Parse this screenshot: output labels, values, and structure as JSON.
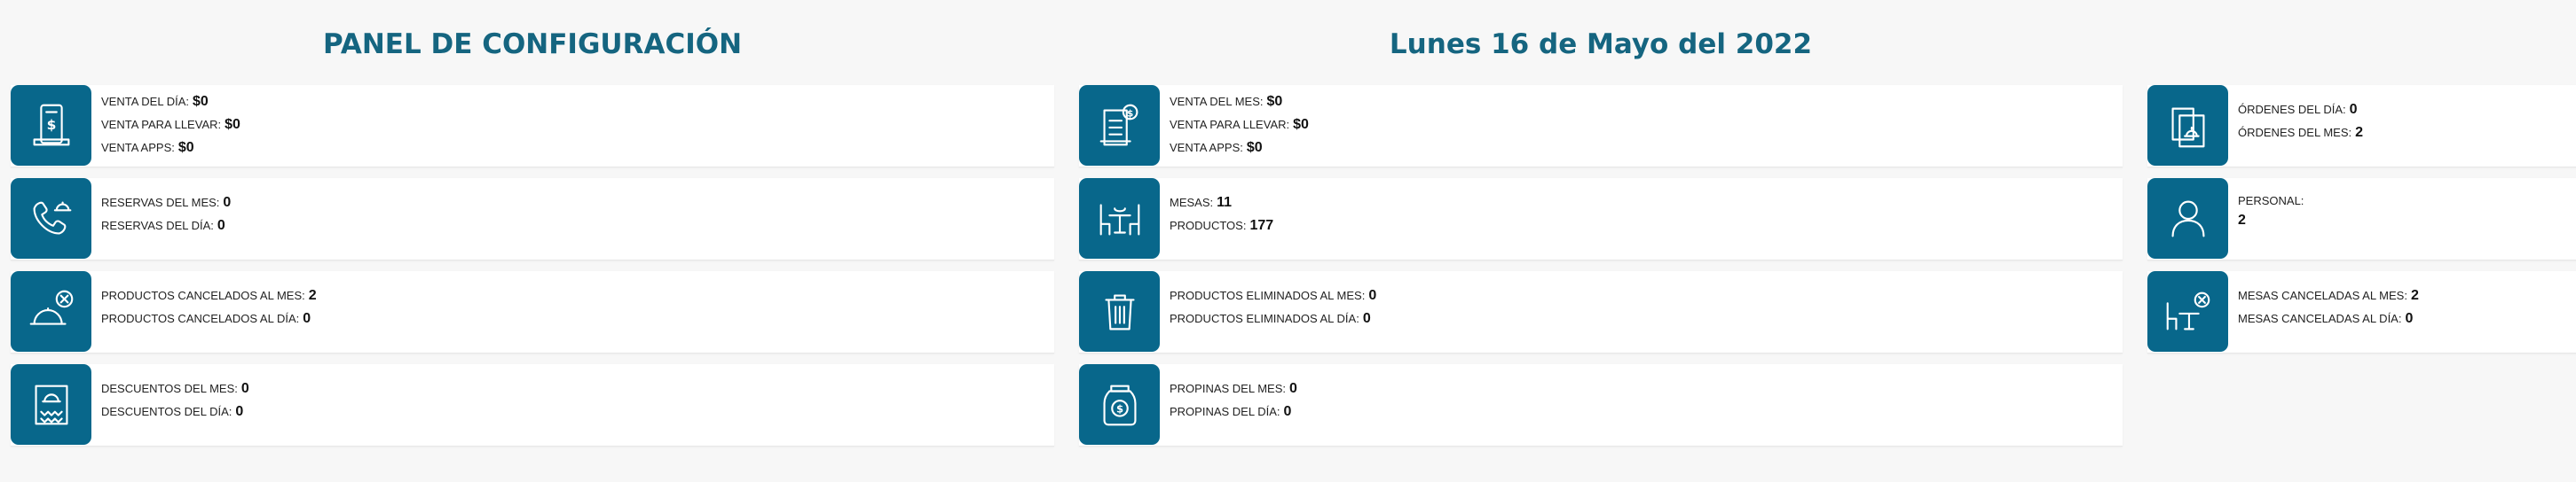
{
  "header": {
    "title": "PANEL DE CONFIGURACIÓN",
    "date": "Lunes 16 de Mayo del 2022"
  },
  "cards": {
    "ventas_dia": {
      "icon": "receipt-dollar-icon",
      "rows": [
        {
          "label": "VENTA DEL DÍA:",
          "value": "$0"
        },
        {
          "label": "VENTA PARA LLEVAR:",
          "value": "$0"
        },
        {
          "label": "VENTA APPS:",
          "value": "$0"
        }
      ]
    },
    "ventas_mes": {
      "icon": "invoice-dollar-icon",
      "rows": [
        {
          "label": "VENTA DEL MES:",
          "value": "$0"
        },
        {
          "label": "VENTA PARA LLEVAR:",
          "value": "$0"
        },
        {
          "label": "VENTA APPS:",
          "value": "$0"
        }
      ]
    },
    "ordenes": {
      "icon": "orders-bell-icon",
      "rows": [
        {
          "label": "ÓRDENES DEL DÍA:",
          "value": "0"
        },
        {
          "label": "ÓRDENES DEL MES:",
          "value": "2"
        }
      ]
    },
    "reservas": {
      "icon": "phone-bell-icon",
      "rows": [
        {
          "label": "RESERVAS DEL MES:",
          "value": "0"
        },
        {
          "label": "RESERVAS DEL DÍA:",
          "value": "0"
        }
      ]
    },
    "mesas_productos": {
      "icon": "table-chairs-icon",
      "rows": [
        {
          "label": "MESAS:",
          "value": "11"
        },
        {
          "label": "PRODUCTOS:",
          "value": "177"
        }
      ]
    },
    "personal": {
      "icon": "user-icon",
      "label": "PERSONAL:",
      "value": "2"
    },
    "productos_cancelados": {
      "icon": "cloche-cancel-icon",
      "rows": [
        {
          "label": "PRODUCTOS CANCELADOS AL MES:",
          "value": "2"
        },
        {
          "label": "PRODUCTOS CANCELADOS AL DÍA:",
          "value": "0"
        }
      ]
    },
    "productos_eliminados": {
      "icon": "trash-icon",
      "rows": [
        {
          "label": "PRODUCTOS ELIMINADOS AL MES:",
          "value": "0"
        },
        {
          "label": "PRODUCTOS ELIMINADOS AL DÍA:",
          "value": "0"
        }
      ]
    },
    "mesas_canceladas": {
      "icon": "table-cancel-icon",
      "rows": [
        {
          "label": "MESAS CANCELADAS AL MES:",
          "value": "2"
        },
        {
          "label": "MESAS CANCELADAS AL DÍA:",
          "value": "0"
        }
      ]
    },
    "descuentos": {
      "icon": "discount-ticket-icon",
      "rows": [
        {
          "label": "DESCUENTOS DEL MES:",
          "value": "0"
        },
        {
          "label": "DESCUENTOS DEL DÍA:",
          "value": "0"
        }
      ]
    },
    "propinas": {
      "icon": "tip-jar-icon",
      "rows": [
        {
          "label": "PROPINAS DEL MES:",
          "value": "0"
        },
        {
          "label": "PROPINAS DEL DÍA:",
          "value": "0"
        }
      ]
    }
  }
}
